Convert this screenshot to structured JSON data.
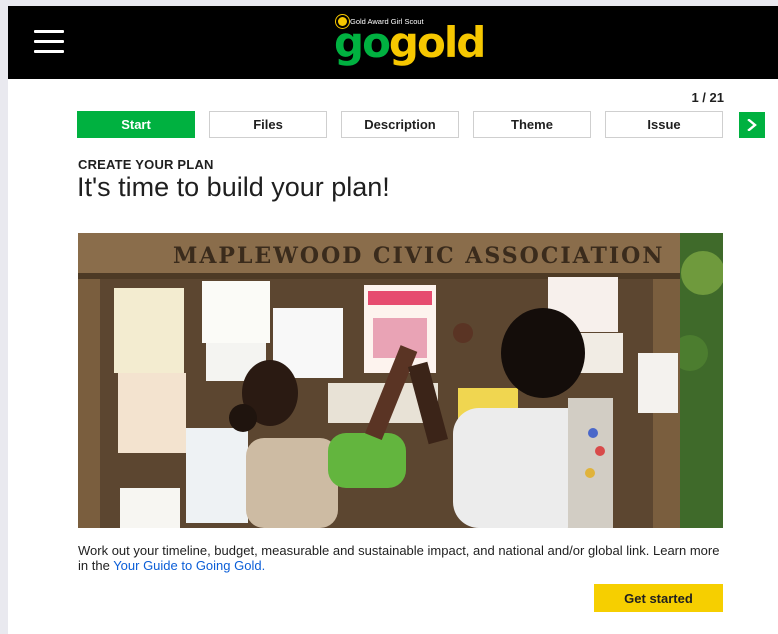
{
  "header": {
    "menu_icon": "hamburger-menu-icon",
    "logo": {
      "tagline": "Gold Award Girl Scout",
      "word_go": "go",
      "word_gold": "gold",
      "brand_green": "#00b140",
      "brand_gold": "#f6c700"
    }
  },
  "progress": {
    "label": "1 / 21",
    "current": 1,
    "total": 21
  },
  "steps": {
    "tabs": [
      {
        "label": "Start",
        "active": true
      },
      {
        "label": "Files",
        "active": false
      },
      {
        "label": "Description",
        "active": false
      },
      {
        "label": "Theme",
        "active": false
      },
      {
        "label": "Issue",
        "active": false
      }
    ],
    "next_icon": "chevron-right-icon"
  },
  "content": {
    "eyebrow": "CREATE YOUR PLAN",
    "title": "It's time to build your plan!",
    "image_sign_text": "MAPLEWOOD CIVIC ASSOCIATION",
    "body_before_link": "Work out your timeline, budget, measurable and sustainable impact, and national and/or global link. Learn more in the ",
    "body_link": "Your Guide to Going Gold.",
    "cta_label": "Get started"
  },
  "colors": {
    "accent_green": "#00b140",
    "cta_yellow": "#f6cf00",
    "link_blue": "#0b5ed7",
    "header_black": "#000000"
  }
}
